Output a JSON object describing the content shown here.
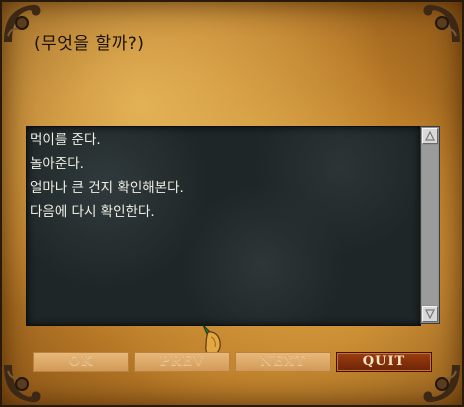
{
  "dialog": {
    "prompt": "(무엇을 할까?)",
    "choices": [
      "먹이를 준다.",
      "놀아준다.",
      "얼마나 큰 건지 확인해본다.",
      "다음에 다시 확인한다."
    ]
  },
  "buttons": {
    "ok": "OK",
    "prev": "PREV",
    "next": "NEXT",
    "quit": "QUIT"
  },
  "colors": {
    "panel_bg": "#1f2627",
    "choice_text": "#f0f0e6",
    "quit_button": "#7a2a08",
    "parchment": "#c58a33"
  },
  "icons": {
    "corners": "ornate-corner-icon",
    "scroll_up": "triangle-up-icon",
    "scroll_down": "triangle-down-icon",
    "cursor": "glove-pointer-icon"
  }
}
